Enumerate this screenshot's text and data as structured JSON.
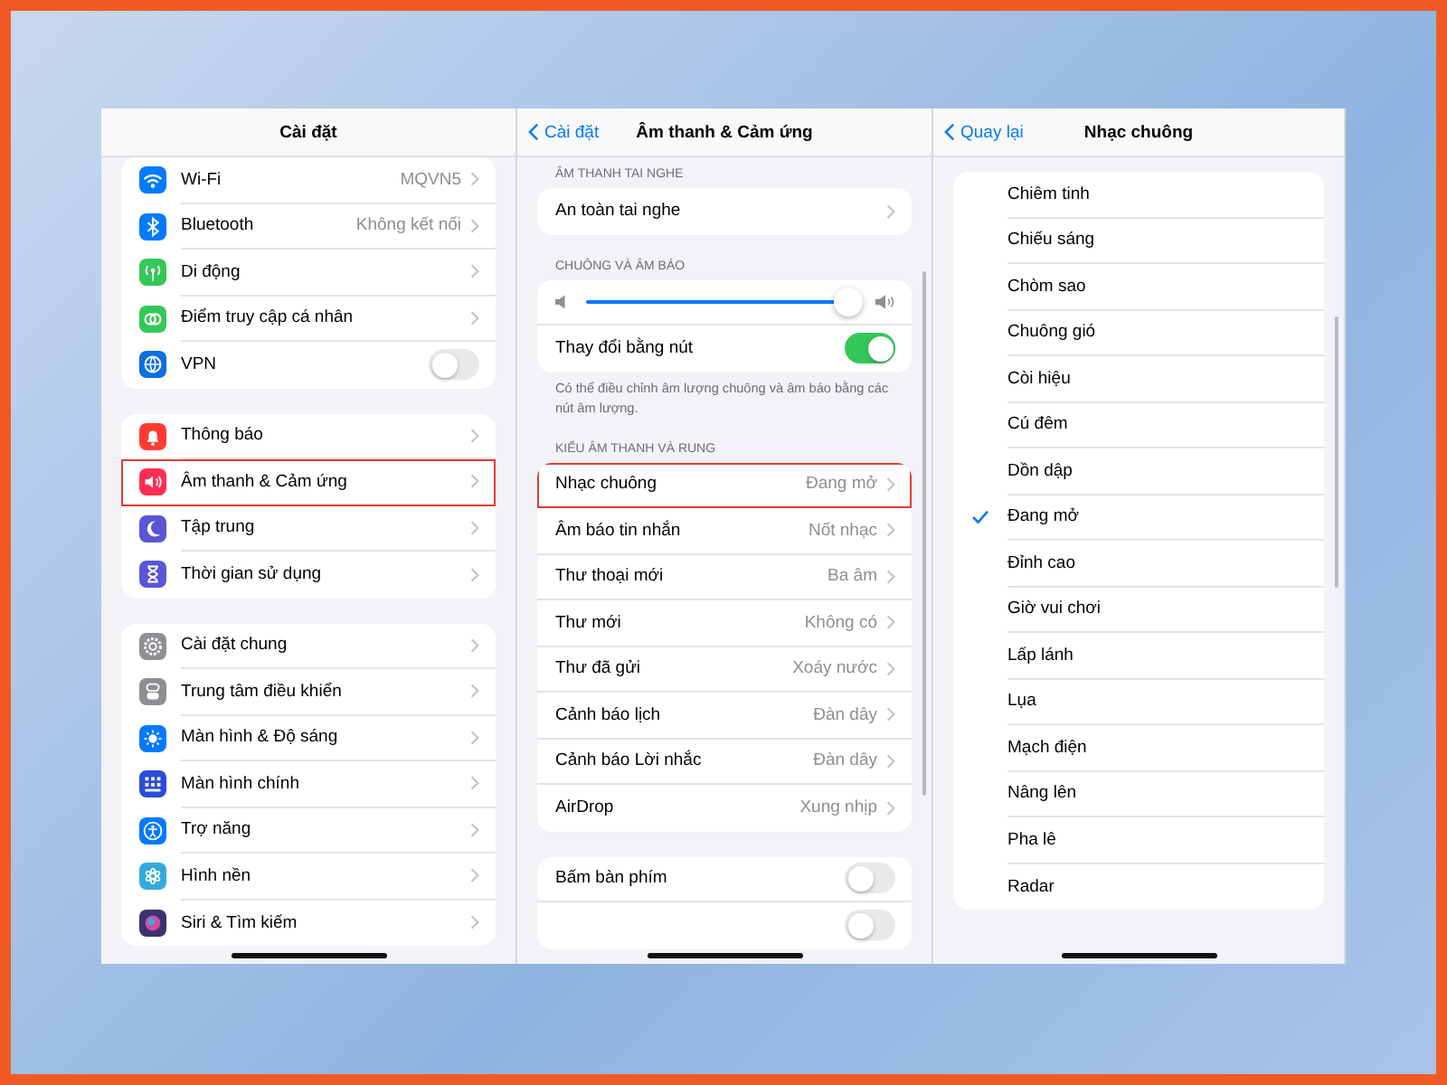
{
  "panels": [
    {
      "title": "Cài đặt",
      "sections": [
        {
          "rows": [
            {
              "kind": "link",
              "label": "Wi-Fi",
              "value": "MQVN5",
              "color": "#007aff",
              "highlighted": false
            },
            {
              "kind": "link",
              "label": "Bluetooth",
              "value": "Không kết nối",
              "color": "#007aff",
              "highlighted": false
            },
            {
              "kind": "link",
              "label": "Di động",
              "color": "#34c759",
              "highlighted": false
            },
            {
              "kind": "link",
              "label": "Điểm truy cập cá nhân",
              "color": "#34c759",
              "highlighted": false
            },
            {
              "kind": "toggle",
              "label": "VPN",
              "on": false,
              "color": "#0a6fe0",
              "highlighted": false
            }
          ]
        },
        {
          "rows": [
            {
              "kind": "link",
              "label": "Thông báo",
              "color": "#ff3b30",
              "highlighted": false
            },
            {
              "kind": "link",
              "label": "Âm thanh & Cảm ứng",
              "color": "#ff2d55",
              "highlighted": true
            },
            {
              "kind": "link",
              "label": "Tập trung",
              "color": "#5856d6",
              "highlighted": false
            },
            {
              "kind": "link",
              "label": "Thời gian sử dụng",
              "color": "#5856d6",
              "highlighted": false
            }
          ]
        },
        {
          "rows": [
            {
              "kind": "link",
              "label": "Cài đặt chung",
              "color": "#8e8e93",
              "highlighted": false
            },
            {
              "kind": "link",
              "label": "Trung tâm điều khiển",
              "color": "#8e8e93",
              "highlighted": false
            },
            {
              "kind": "link",
              "label": "Màn hình & Độ sáng",
              "color": "#007aff",
              "highlighted": false
            },
            {
              "kind": "link",
              "label": "Màn hình chính",
              "color": "#2c4bd8",
              "highlighted": false
            },
            {
              "kind": "link",
              "label": "Trợ năng",
              "color": "#007aff",
              "highlighted": false
            },
            {
              "kind": "link",
              "label": "Hình nền",
              "color": "#34aadc",
              "highlighted": false
            },
            {
              "kind": "link",
              "label": "Siri & Tìm kiếm",
              "color": "#3b3270",
              "highlighted": false
            }
          ]
        }
      ]
    },
    {
      "back": "Cài đặt",
      "title": "Âm thanh & Cảm ứng",
      "sections": [
        {
          "header": "ÂM THANH TAI NGHE",
          "rows": [
            {
              "kind": "link",
              "label": "An toàn tai nghe",
              "highlighted": false
            }
          ]
        },
        {
          "header": "CHUÔNG VÀ ÂM BÁO",
          "footnote": "Có thể điều chỉnh âm lượng chuông và âm báo bằng các nút âm lượng.",
          "rows": [
            {
              "kind": "slider",
              "level": 0.97
            },
            {
              "kind": "toggle",
              "label": "Thay đổi bằng nút",
              "on": true,
              "highlighted": false
            }
          ]
        },
        {
          "header": "KIỂU ÂM THANH VÀ RUNG",
          "rows": [
            {
              "kind": "link",
              "label": "Nhạc chuông",
              "value": "Đang mở",
              "highlighted": true
            },
            {
              "kind": "link",
              "label": "Âm báo tin nhắn",
              "value": "Nốt nhạc",
              "highlighted": false
            },
            {
              "kind": "link",
              "label": "Thư thoại mới",
              "value": "Ba âm",
              "highlighted": false
            },
            {
              "kind": "link",
              "label": "Thư mới",
              "value": "Không có",
              "highlighted": false
            },
            {
              "kind": "link",
              "label": "Thư đã gửi",
              "value": "Xoáy nước",
              "highlighted": false
            },
            {
              "kind": "link",
              "label": "Cảnh báo lịch",
              "value": "Đàn dây",
              "highlighted": false
            },
            {
              "kind": "link",
              "label": "Cảnh báo Lời nhắc",
              "value": "Đàn dây",
              "highlighted": false
            },
            {
              "kind": "link",
              "label": "AirDrop",
              "value": "Xung nhịp",
              "highlighted": false
            }
          ]
        },
        {
          "rows": [
            {
              "kind": "toggle",
              "label": "Bấm bàn phím",
              "on": false,
              "highlighted": false
            },
            {
              "kind": "toggle",
              "on": false,
              "highlighted": false
            }
          ]
        }
      ]
    },
    {
      "back": "Quay lại",
      "title": "Nhạc chuông",
      "sections": [
        {
          "rows": [
            {
              "kind": "option",
              "label": "Chiêm tinh",
              "selected": false
            },
            {
              "kind": "option",
              "label": "Chiếu sáng",
              "selected": false
            },
            {
              "kind": "option",
              "label": "Chòm sao",
              "selected": false
            },
            {
              "kind": "option",
              "label": "Chuông gió",
              "selected": false
            },
            {
              "kind": "option",
              "label": "Còi hiệu",
              "selected": false
            },
            {
              "kind": "option",
              "label": "Cú đêm",
              "selected": false
            },
            {
              "kind": "option",
              "label": "Dồn dập",
              "selected": false
            },
            {
              "kind": "option",
              "label": "Đang mở",
              "selected": true
            },
            {
              "kind": "option",
              "label": "Đỉnh cao",
              "selected": false
            },
            {
              "kind": "option",
              "label": "Giờ vui chơi",
              "selected": false
            },
            {
              "kind": "option",
              "label": "Lấp lánh",
              "selected": false
            },
            {
              "kind": "option",
              "label": "Lụa",
              "selected": false
            },
            {
              "kind": "option",
              "label": "Mạch điện",
              "selected": false
            },
            {
              "kind": "option",
              "label": "Nâng lên",
              "selected": false
            },
            {
              "kind": "option",
              "label": "Pha lê",
              "selected": false
            },
            {
              "kind": "option",
              "label": "Radar",
              "selected": false
            }
          ]
        }
      ]
    }
  ]
}
